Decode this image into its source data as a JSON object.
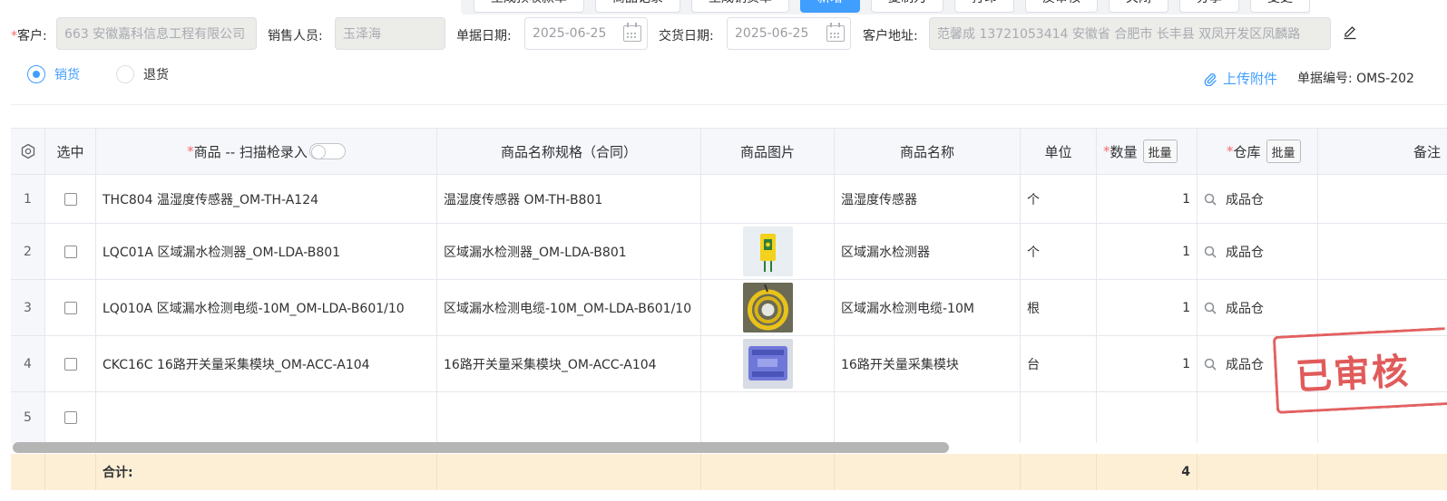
{
  "toolbar": {
    "buttons": [
      {
        "label": "生成预收款单",
        "primary": false
      },
      {
        "label": "商品记录",
        "primary": false
      },
      {
        "label": "生成销货单",
        "primary": false
      },
      {
        "label": "新增",
        "primary": true
      },
      {
        "label": "复制为",
        "primary": false
      },
      {
        "label": "打印",
        "primary": false
      },
      {
        "label": "反审核",
        "primary": false
      },
      {
        "label": "关闭",
        "primary": false
      },
      {
        "label": "分享",
        "primary": false
      },
      {
        "label": "变更",
        "primary": false
      }
    ]
  },
  "form": {
    "customer_label": "客户:",
    "customer_value": "663 安徽嘉科信息工程有限公司",
    "salesperson_label": "销售人员:",
    "salesperson_value": "玉泽海",
    "bill_date_label": "单据日期:",
    "bill_date_value": "2025-06-25",
    "delivery_date_label": "交货日期:",
    "delivery_date_value": "2025-06-25",
    "address_label": "客户地址:",
    "address_value": "范馨成 13721053414 安徽省 合肥市 长丰县 双凤开发区凤麟路"
  },
  "mode": {
    "options": [
      {
        "label": "销货",
        "checked": true
      },
      {
        "label": "退货",
        "checked": false
      }
    ]
  },
  "upload_label": "上传附件",
  "bill_no": "单据编号: OMS-202",
  "table": {
    "headers": {
      "select": "选中",
      "product": "商品 -- 扫描枪录入",
      "spec": "商品名称规格（合同）",
      "image": "商品图片",
      "name": "商品名称",
      "unit": "单位",
      "qty": "数量",
      "warehouse": "仓库",
      "remark": "备注",
      "batch": "批量"
    },
    "rows": [
      {
        "index": "1",
        "product": "THC804 温湿度传感器_OM-TH-A124",
        "spec": "温湿度传感器 OM-TH-B801",
        "image": "",
        "name": "温湿度传感器",
        "unit": "个",
        "qty": "1",
        "warehouse": "成品仓"
      },
      {
        "index": "2",
        "product": "LQC01A 区域漏水检测器_OM-LDA-B801",
        "spec": "区域漏水检测器_OM-LDA-B801",
        "image": "leak-detector",
        "name": "区域漏水检测器",
        "unit": "个",
        "qty": "1",
        "warehouse": "成品仓"
      },
      {
        "index": "3",
        "product": "LQ010A 区域漏水检测电缆-10M_OM-LDA-B601/10",
        "spec": "区域漏水检测电缆-10M_OM-LDA-B601/10",
        "image": "cable-coil",
        "name": "区域漏水检测电缆-10M",
        "unit": "根",
        "qty": "1",
        "warehouse": "成品仓"
      },
      {
        "index": "4",
        "product": "CKC16C 16路开关量采集模块_OM-ACC-A104",
        "spec": "16路开关量采集模块_OM-ACC-A104",
        "image": "io-module",
        "name": "16路开关量采集模块",
        "unit": "台",
        "qty": "1",
        "warehouse": "成品仓"
      },
      {
        "index": "5",
        "product": "",
        "spec": "",
        "image": "",
        "name": "",
        "unit": "",
        "qty": "",
        "warehouse": ""
      }
    ],
    "total_label": "合计:",
    "total_qty": "4"
  },
  "stamp_text": "已审核",
  "colors": {
    "accent": "#409eff",
    "required": "#f56c6c",
    "stamp": "#de4a4a",
    "total_bg": "#fdefd6"
  }
}
